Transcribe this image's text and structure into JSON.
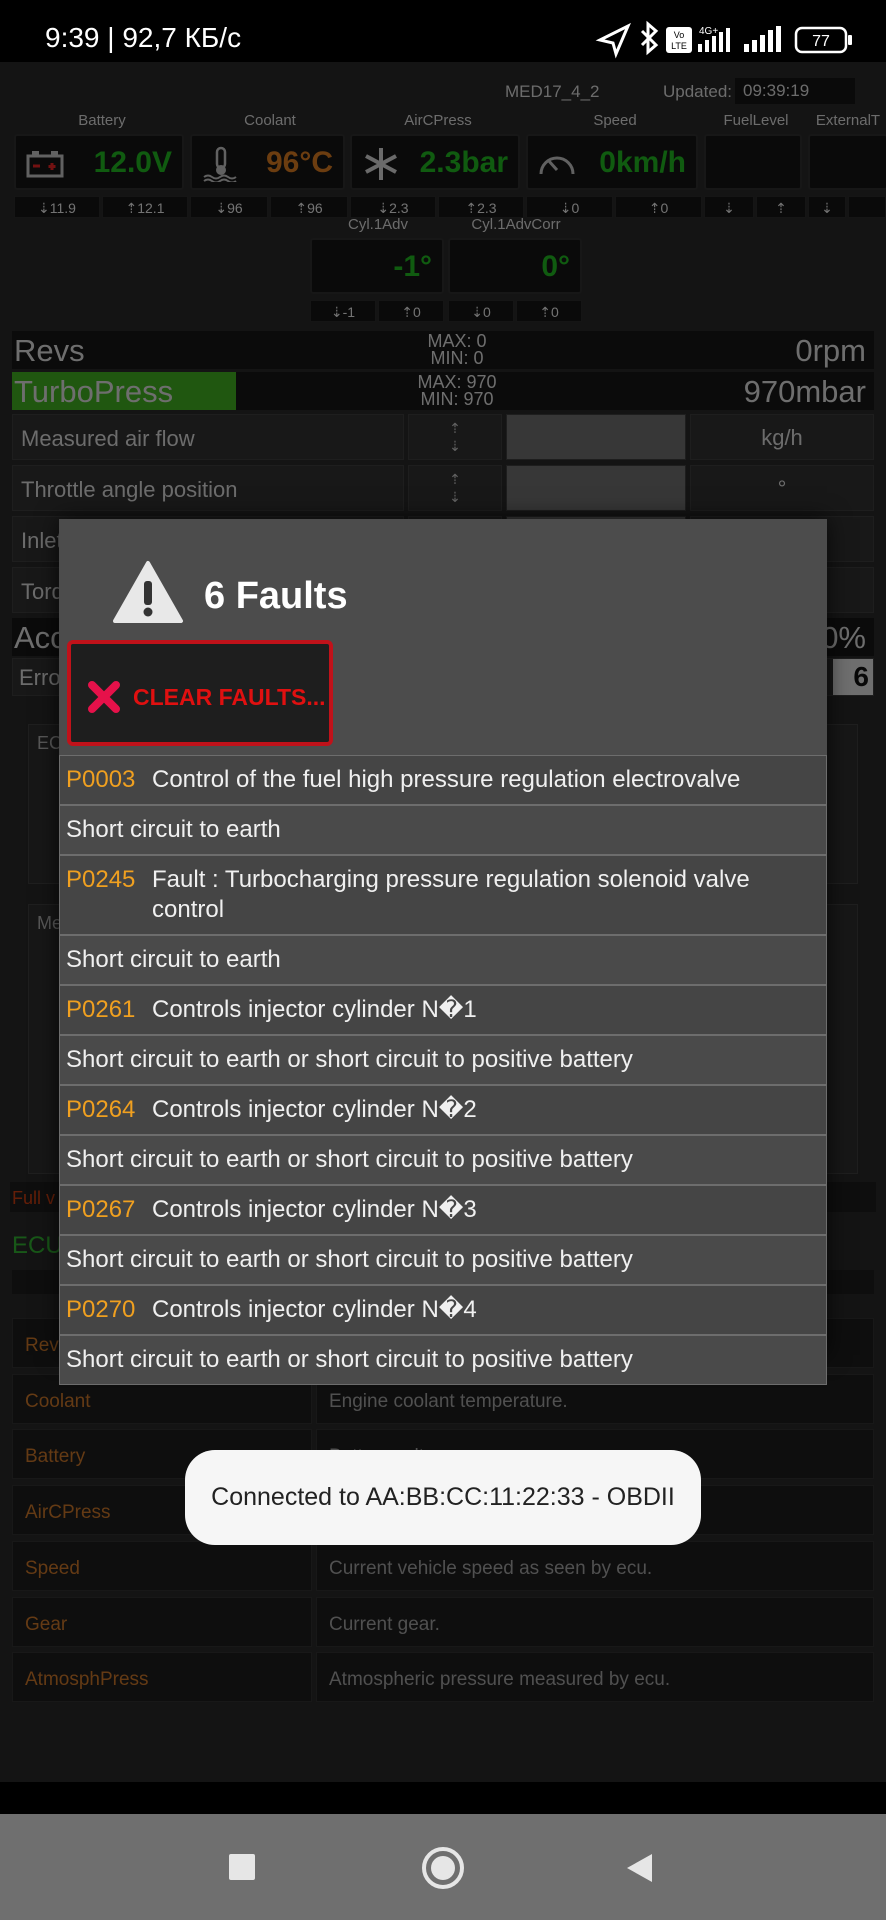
{
  "status_bar": {
    "time": "9:39 | 92,7 КБ/с",
    "battery": "77",
    "network_label": "4G+",
    "volte_label": "Vo LTE"
  },
  "header": {
    "ecu": "MED17_4_2",
    "updated_label": "Updated:",
    "updated_time": "09:39:19"
  },
  "gauges": [
    {
      "label": "Battery",
      "value": "12.0V",
      "color": "#1fae1f",
      "icon": "battery-icon",
      "min": "⇣11.9",
      "max": "⇡12.1"
    },
    {
      "label": "Coolant",
      "value": "96°C",
      "color": "#d0761f",
      "icon": "thermometer-icon",
      "min": "⇣96",
      "max": "⇡96"
    },
    {
      "label": "AirCPress",
      "value": "2.3bar",
      "color": "#1fae1f",
      "icon": "snowflake-icon",
      "min": "⇣2.3",
      "max": "⇡2.3"
    },
    {
      "label": "Speed",
      "value": "0km/h",
      "color": "#1fae1f",
      "icon": "speedometer-icon",
      "min": "⇣0",
      "max": "⇡0"
    },
    {
      "label": "FuelLevel",
      "value": "",
      "min": "⇣",
      "max": "⇡"
    },
    {
      "label": "ExternalT",
      "value": "",
      "min": "⇣",
      "max": ""
    }
  ],
  "cyl": [
    {
      "label": "Cyl.1Adv",
      "value": "-1°",
      "min": "⇣-1",
      "max": "⇡0"
    },
    {
      "label": "Cyl.1AdvCorr",
      "value": "0°",
      "min": "⇣0",
      "max": "⇡0"
    }
  ],
  "revs": {
    "name": "Revs",
    "max": "MAX: 0",
    "min": "MIN: 0",
    "value": "0rpm"
  },
  "turbo": {
    "name": "TurboPress",
    "max": "MAX: 970",
    "min": "MIN: 970",
    "value": "970mbar",
    "bar_fraction": 0.26
  },
  "params": [
    {
      "label": "Measured air flow",
      "unit": "kg/h"
    },
    {
      "label": "Throttle angle position",
      "unit": "°"
    },
    {
      "label": "Inlet",
      "unit": ""
    },
    {
      "label": "Torq",
      "unit": ""
    }
  ],
  "acc": {
    "name": "Acc",
    "value": "0%"
  },
  "errors": {
    "label": "Erro",
    "value": "6"
  },
  "ecu_box_label": "EC",
  "me_box_label": "Me",
  "fullvalue_label": "Full v",
  "ecu_label": "ECU",
  "table": [
    {
      "name": "Rev",
      "desc": ""
    },
    {
      "name": "Coolant",
      "desc": "Engine coolant temperature."
    },
    {
      "name": "Battery",
      "desc": "Battery voltage."
    },
    {
      "name": "AirCPress",
      "desc": ""
    },
    {
      "name": "Speed",
      "desc": "Current vehicle speed as seen by ecu."
    },
    {
      "name": "Gear",
      "desc": "Current gear."
    },
    {
      "name": "AtmosphPress",
      "desc": "Atmospheric pressure measured by ecu."
    }
  ],
  "dialog": {
    "title": "6 Faults",
    "clear_label": "CLEAR FAULTS...",
    "faults": [
      {
        "code": "P0003",
        "desc": "Control of the fuel high pressure regulation electrovalve",
        "detail": "Short circuit to earth"
      },
      {
        "code": "P0245",
        "desc": "Fault : Turbocharging pressure regulation solenoid valve control",
        "detail": "Short circuit to earth"
      },
      {
        "code": "P0261",
        "desc": "Controls injector cylinder N�1",
        "detail": "Short circuit to earth or short circuit to positive battery"
      },
      {
        "code": "P0264",
        "desc": "Controls injector cylinder N�2",
        "detail": "Short circuit to earth or short circuit to positive battery"
      },
      {
        "code": "P0267",
        "desc": "Controls injector cylinder N�3",
        "detail": "Short circuit to earth or short circuit to positive battery"
      },
      {
        "code": "P0270",
        "desc": "Controls injector cylinder N�4",
        "detail": "Short circuit to earth or short circuit to positive battery"
      }
    ]
  },
  "toast": "Connected to AA:BB:CC:11:22:33 - OBDII",
  "colors": {
    "accent_orange": "#f0a020",
    "alert_red": "#e01010",
    "value_green": "#1fae1f",
    "turbo_green": "#3fa81f"
  }
}
